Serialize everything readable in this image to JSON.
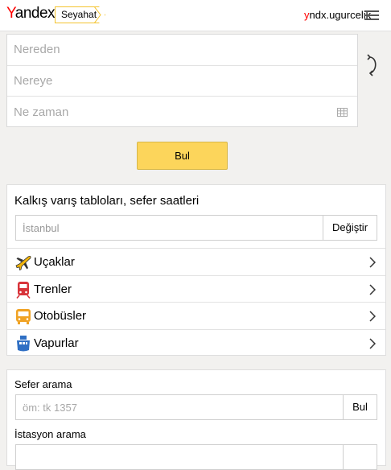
{
  "header": {
    "logo_first": "Y",
    "logo_rest": "andex",
    "service_label": "Seyahat",
    "user_first": "y",
    "user_rest": "ndx.ugurcelik"
  },
  "search": {
    "from_placeholder": "Nereden",
    "to_placeholder": "Nereye",
    "date_placeholder": "Ne zaman",
    "submit_label": "Bul"
  },
  "timetable": {
    "title": "Kalkış varış tabloları, sefer saatleri",
    "city_placeholder": "İstanbul",
    "change_label": "Değiştir",
    "items": [
      {
        "label": "Uçaklar",
        "icon": "plane-icon"
      },
      {
        "label": "Trenler",
        "icon": "train-icon"
      },
      {
        "label": "Otobüsler",
        "icon": "bus-icon"
      },
      {
        "label": "Vapurlar",
        "icon": "ferry-icon"
      }
    ]
  },
  "trip_search": {
    "label": "Sefer arama",
    "placeholder": "öm: tk 1357",
    "button_label": "Bul",
    "station_label": "İstasyon arama"
  },
  "colors": {
    "accent_yellow": "#fcd55b",
    "logo_red": "#ff0000",
    "background": "#f2f1ef"
  }
}
